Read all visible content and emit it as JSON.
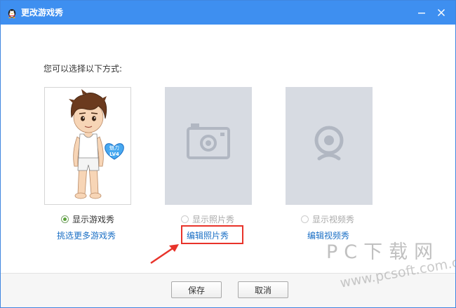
{
  "window": {
    "title": "更改游戏秀",
    "accent": "#3e8ff0"
  },
  "prompt": "您可以选择以下方式:",
  "options": [
    {
      "label": "显示游戏秀",
      "checked": true,
      "enabled": true,
      "link": "挑选更多游戏秀",
      "icon": "avatar-figure"
    },
    {
      "label": "显示照片秀",
      "checked": false,
      "enabled": false,
      "link": "编辑照片秀",
      "icon": "camera-icon"
    },
    {
      "label": "显示视频秀",
      "checked": false,
      "enabled": false,
      "link": "编辑视频秀",
      "icon": "webcam-icon"
    }
  ],
  "badge": {
    "line1": "魅力",
    "line2": "LV4"
  },
  "buttons": {
    "save": "保存",
    "cancel": "取消"
  },
  "watermark": {
    "brand": "PC下载网",
    "url": "www.pcsoft.com.cn"
  }
}
